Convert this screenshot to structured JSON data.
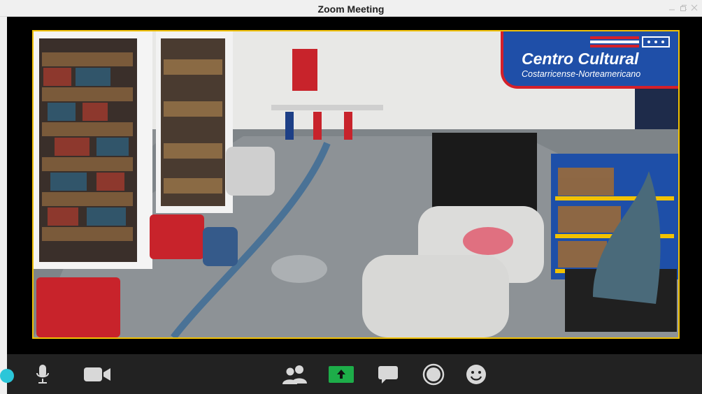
{
  "window": {
    "title": "Zoom Meeting"
  },
  "window_controls": [
    "minimize-icon",
    "restore-icon",
    "close-icon"
  ],
  "video": {
    "banner": {
      "title": "Centro Cultural",
      "subtitle": "Costarricense-Norteamericano",
      "colors": {
        "blue": "#1f4fa8",
        "red": "#d4202a"
      }
    },
    "border_color": "#f2c200"
  },
  "toolbar": {
    "items": [
      "microphone-icon",
      "video-camera-icon",
      "participants-icon",
      "share-screen-icon",
      "chat-icon",
      "record-icon",
      "reactions-icon"
    ],
    "share_color": "#1dad49"
  }
}
